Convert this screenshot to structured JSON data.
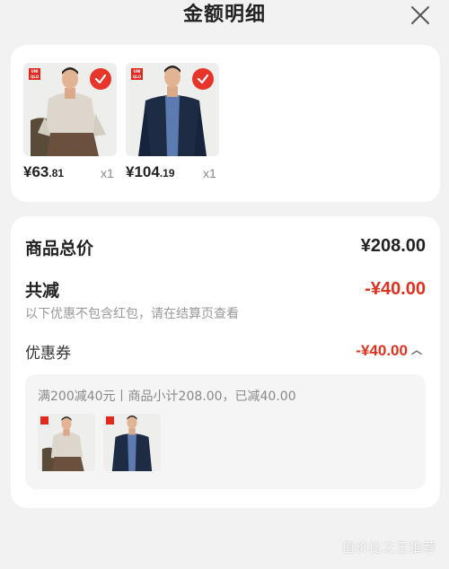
{
  "header": {
    "title": "金额明细"
  },
  "products": [
    {
      "price_int": "¥63",
      "price_dec": ".81",
      "qty": "x1",
      "brand": "UNI QLO"
    },
    {
      "price_int": "¥104",
      "price_dec": ".19",
      "qty": "x1",
      "brand": "UNI QLO"
    }
  ],
  "summary": {
    "total_label": "商品总价",
    "total_value": "¥208.00",
    "reduce_label": "共减",
    "reduce_value": "-¥40.00",
    "note": "以下优惠不包含红包，请在结算页查看",
    "coupon_label": "优惠券",
    "coupon_value": "-¥40.00"
  },
  "coupon_detail": {
    "text": "满200减40元丨商品小计208.00，已减40.00"
  },
  "watermark": "值价比之王推荐",
  "colors": {
    "accent": "#e0301e",
    "card_bg": "#ffffff",
    "page_bg": "#f2f2f2"
  }
}
